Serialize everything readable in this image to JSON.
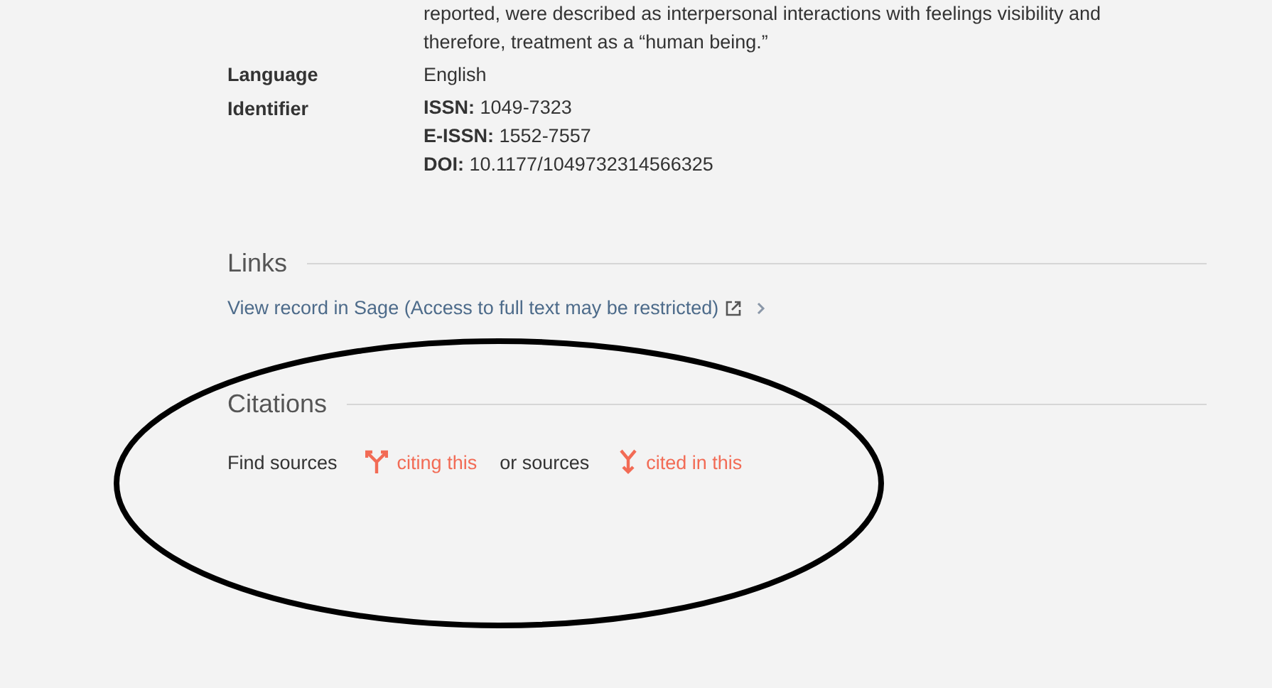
{
  "description_tail": [
    "reported, were described as interpersonal interactions with feelings visibility and",
    "therefore, treatment as a “human being.”"
  ],
  "details": [
    {
      "label": "Language",
      "values": [
        {
          "text": "English"
        }
      ]
    },
    {
      "label": "Identifier",
      "values": [
        {
          "key": "ISSN:",
          "text": "1049-7323"
        },
        {
          "key": "E-ISSN:",
          "text": "1552-7557"
        },
        {
          "key": "DOI:",
          "text": "10.1177/1049732314566325"
        }
      ]
    }
  ],
  "links": {
    "heading": "Links",
    "items": [
      {
        "text": "View record in Sage (Access to full text may be restricted)"
      }
    ]
  },
  "citations": {
    "heading": "Citations",
    "parts": [
      {
        "kind": "text",
        "text": "Find sources"
      },
      {
        "kind": "citing",
        "text": "citing this"
      },
      {
        "kind": "text",
        "text": "or sources"
      },
      {
        "kind": "cited",
        "text": "cited in this"
      }
    ]
  },
  "annotation": {
    "kind": "ellipse"
  }
}
